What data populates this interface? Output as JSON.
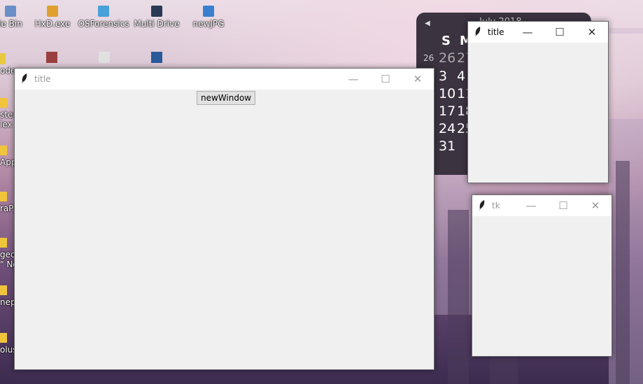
{
  "desktop": {
    "icons_top": [
      {
        "label": "le Bin",
        "icon": "recycle-bin-icon",
        "color": "#6a8fc8"
      },
      {
        "label": "HxD.exe",
        "icon": "hxd-icon",
        "color": "#e0a030"
      },
      {
        "label": "OSForensics",
        "icon": "osforensics-icon",
        "color": "#4aa0d8"
      },
      {
        "label": "Multi Drive",
        "icon": "multi-drive-icon",
        "color": "#2a3a55"
      },
      {
        "label": "newJPG",
        "icon": "image-file-icon",
        "color": "#3a7fcf"
      }
    ],
    "icons_second_row": [
      {
        "icon": "app-icon-1",
        "color": "#9a3f3f"
      },
      {
        "icon": "app-icon-2",
        "color": "#e0e0e0"
      },
      {
        "icon": "app-icon-3",
        "color": "#2a5a9a"
      },
      {
        "icon": "app-icon-4",
        "color": "#e8c840"
      }
    ],
    "left_labels": [
      "ode",
      "ster\nlex",
      "Apps",
      "raPy",
      "geor\n\" No",
      "nepa",
      "olush"
    ]
  },
  "calendar": {
    "month_label": "July 2018",
    "header_days": [
      "S",
      "M"
    ],
    "week_number": "26",
    "days": [
      {
        "value": "26",
        "dim": true
      },
      {
        "value": "27",
        "dim": true
      },
      {
        "value": "3",
        "dim": false
      },
      {
        "value": "4",
        "dim": false
      },
      {
        "value": "10",
        "dim": false
      },
      {
        "value": "11",
        "dim": false
      },
      {
        "value": "17",
        "dim": false
      },
      {
        "value": "18",
        "dim": false
      },
      {
        "value": "24",
        "dim": false
      },
      {
        "value": "25",
        "dim": false
      },
      {
        "value": "31",
        "dim": false
      }
    ]
  },
  "windows": {
    "main": {
      "title": "title",
      "button_label": "newWindow",
      "minimize": "—",
      "maximize": "☐",
      "close": "✕"
    },
    "topright": {
      "title": "title",
      "minimize": "—",
      "maximize": "☐",
      "close": "✕"
    },
    "tk": {
      "title": "tk",
      "minimize": "—",
      "maximize": "☐",
      "close": "✕"
    }
  }
}
